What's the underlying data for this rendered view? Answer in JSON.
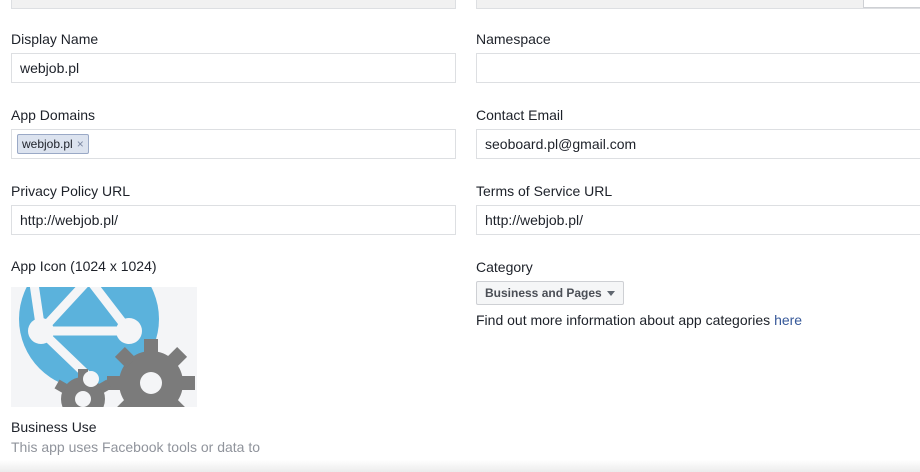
{
  "fields": {
    "display_name": {
      "label": "Display Name",
      "value": "webjob.pl"
    },
    "namespace": {
      "label": "Namespace",
      "value": ""
    },
    "app_domains": {
      "label": "App Domains",
      "tokens": [
        "webjob.pl"
      ]
    },
    "contact_email": {
      "label": "Contact Email",
      "value": "seoboard.pl@gmail.com"
    },
    "privacy_policy_url": {
      "label": "Privacy Policy URL",
      "value": "http://webjob.pl/"
    },
    "terms_of_service_url": {
      "label": "Terms of Service URL",
      "value": "http://webjob.pl/"
    },
    "app_icon": {
      "label": "App Icon (1024 x 1024)"
    },
    "category": {
      "label": "Category",
      "selected": "Business and Pages",
      "info_text": "Find out more information about app categories",
      "info_link": "here"
    },
    "business_use": {
      "label": "Business Use",
      "description": "This app uses Facebook tools or data to"
    }
  },
  "colors": {
    "link": "#365899",
    "token_bg": "#dce3ef",
    "icon_blue": "#5bb2dc",
    "gear_gray": "#7b7b7b"
  },
  "icons": {
    "token_remove": "×",
    "category_caret": "caret-down-icon"
  }
}
